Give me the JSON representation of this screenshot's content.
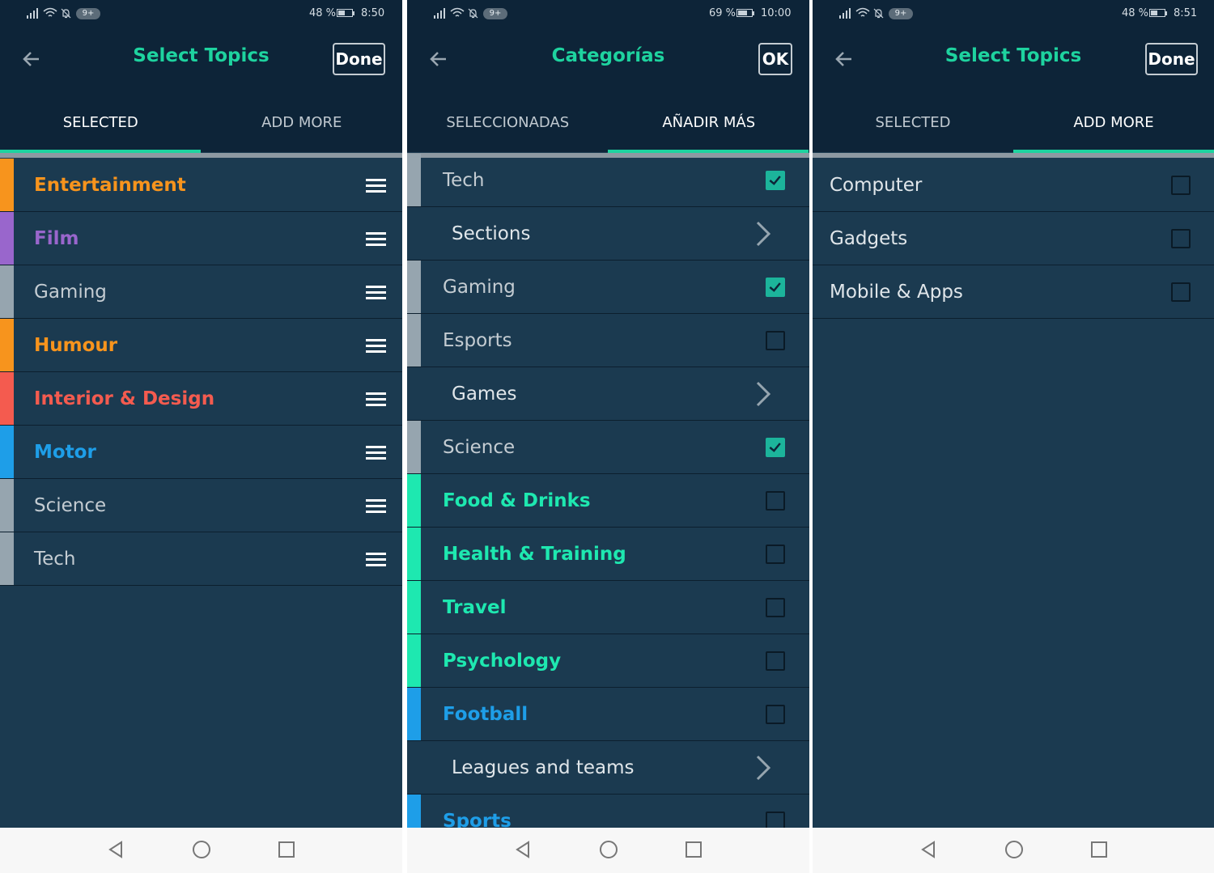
{
  "colors": {
    "statusbar_bg": "#0d2438",
    "header_bg": "#0d2438",
    "list_bg": "#1b3a50",
    "accent_green": "#1ed39f",
    "checked_box": "#1cb49b",
    "entertainment": "#f7941d",
    "film": "#9966cc",
    "gray_topic": "#96a5af",
    "interior": "#f45b4f",
    "blue_topic": "#1e9ee8",
    "green_topic": "#1ee8b0"
  },
  "icons": {
    "back": "arrow-left-icon",
    "drag": "drag-handle-icon",
    "chevron": "chevron-right-icon",
    "nav_back": "triangle-back-icon",
    "nav_home": "circle-home-icon",
    "nav_recent": "square-recent-icon"
  },
  "screens": [
    {
      "status": {
        "notif": "9+",
        "battery": "48 %",
        "battery_level": 0.48,
        "time": "8:50"
      },
      "title": "Select Topics",
      "action": "Done",
      "tabs": [
        {
          "label": "SELECTED",
          "active": true
        },
        {
          "label": "ADD MORE",
          "active": false
        }
      ],
      "rows": [
        {
          "label": "Entertainment",
          "color": "#f7941d",
          "bold": true
        },
        {
          "label": "Film",
          "color": "#9966cc",
          "bold": true
        },
        {
          "label": "Gaming",
          "color": "#96a5af",
          "bold": false
        },
        {
          "label": "Humour",
          "color": "#f7941d",
          "bold": true
        },
        {
          "label": "Interior & Design",
          "color": "#f45b4f",
          "bold": true
        },
        {
          "label": "Motor",
          "color": "#1e9ee8",
          "bold": true
        },
        {
          "label": "Science",
          "color": "#96a5af",
          "bold": false
        },
        {
          "label": "Tech",
          "color": "#96a5af",
          "bold": false
        }
      ]
    },
    {
      "status": {
        "notif": "9+",
        "battery": "69 %",
        "battery_level": 0.69,
        "time": "10:00"
      },
      "title": "Categorías",
      "action": "OK",
      "tabs": [
        {
          "label": "SELECCIONADAS",
          "active": false
        },
        {
          "label": "AÑADIR MÁS",
          "active": true
        }
      ],
      "rows": [
        {
          "label": "Tech",
          "kind": "check",
          "checked": true,
          "color": "#96a5af"
        },
        {
          "label": "Sections",
          "kind": "sub"
        },
        {
          "label": "Gaming",
          "kind": "check",
          "checked": true,
          "color": "#96a5af"
        },
        {
          "label": "Esports",
          "kind": "check",
          "checked": false,
          "color": "#96a5af"
        },
        {
          "label": "Games",
          "kind": "sub"
        },
        {
          "label": "Science",
          "kind": "check",
          "checked": true,
          "color": "#96a5af"
        },
        {
          "label": "Food & Drinks",
          "kind": "check",
          "checked": false,
          "color": "#1ee8b0"
        },
        {
          "label": "Health & Training",
          "kind": "check",
          "checked": false,
          "color": "#1ee8b0"
        },
        {
          "label": "Travel",
          "kind": "check",
          "checked": false,
          "color": "#1ee8b0"
        },
        {
          "label": "Psychology",
          "kind": "check",
          "checked": false,
          "color": "#1ee8b0"
        },
        {
          "label": "Football",
          "kind": "check",
          "checked": false,
          "color": "#1e9ee8"
        },
        {
          "label": "Leagues and teams",
          "kind": "sub"
        },
        {
          "label": "Sports",
          "kind": "check",
          "checked": false,
          "color": "#1e9ee8"
        }
      ]
    },
    {
      "status": {
        "notif": "9+",
        "battery": "48 %",
        "battery_level": 0.48,
        "time": "8:51"
      },
      "title": "Select Topics",
      "action": "Done",
      "tabs": [
        {
          "label": "SELECTED",
          "active": false
        },
        {
          "label": "ADD MORE",
          "active": true
        }
      ],
      "rows": [
        {
          "label": "Computer",
          "kind": "check",
          "checked": false
        },
        {
          "label": "Gadgets",
          "kind": "check",
          "checked": false
        },
        {
          "label": "Mobile & Apps",
          "kind": "check",
          "checked": false
        }
      ]
    }
  ]
}
